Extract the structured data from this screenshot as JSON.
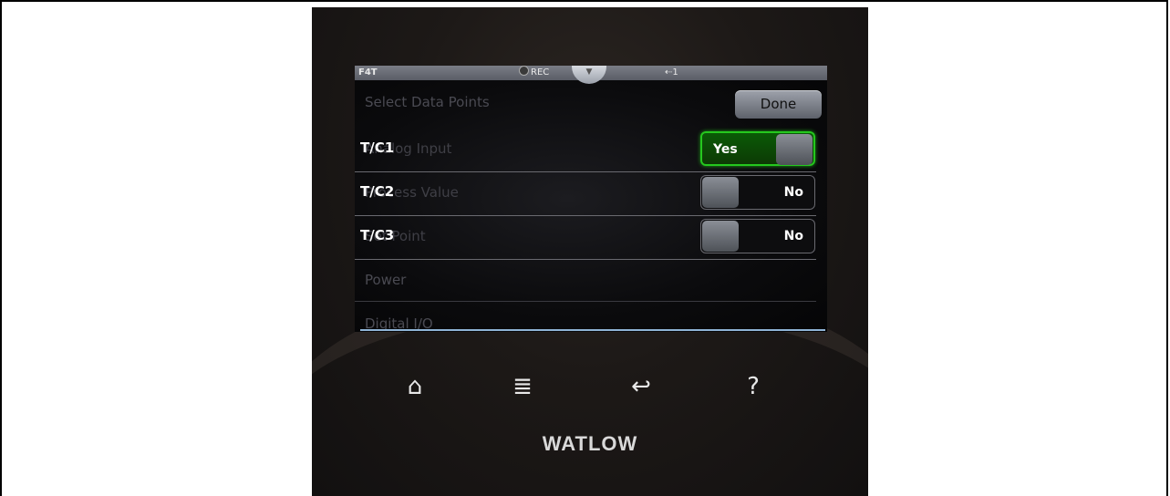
{
  "status_bar": {
    "model": "F4T",
    "rec_label": "REC",
    "tab_handle_icon": "chevron-down-icon",
    "usb_label": "1"
  },
  "screen": {
    "title": "Select Data Points",
    "done_label": "Done"
  },
  "rows": [
    {
      "label": "T/C1",
      "ghost": "Analog Input",
      "toggle": "Yes",
      "on": true
    },
    {
      "label": "T/C2",
      "ghost": "Process Value",
      "toggle": "No",
      "on": false
    },
    {
      "label": "T/C3",
      "ghost": "Set Point",
      "toggle": "No",
      "on": false
    }
  ],
  "static_rows": [
    {
      "ghost": "Power"
    },
    {
      "ghost": "Digital I/O"
    }
  ],
  "nav": {
    "home_icon": "home-icon",
    "menu_icon": "menu-icon",
    "back_icon": "back-icon",
    "help_icon": "help-icon"
  },
  "brand": "WATLOW",
  "colors": {
    "toggle_on": "#25c81e",
    "status_bar": "#6a6d76"
  }
}
